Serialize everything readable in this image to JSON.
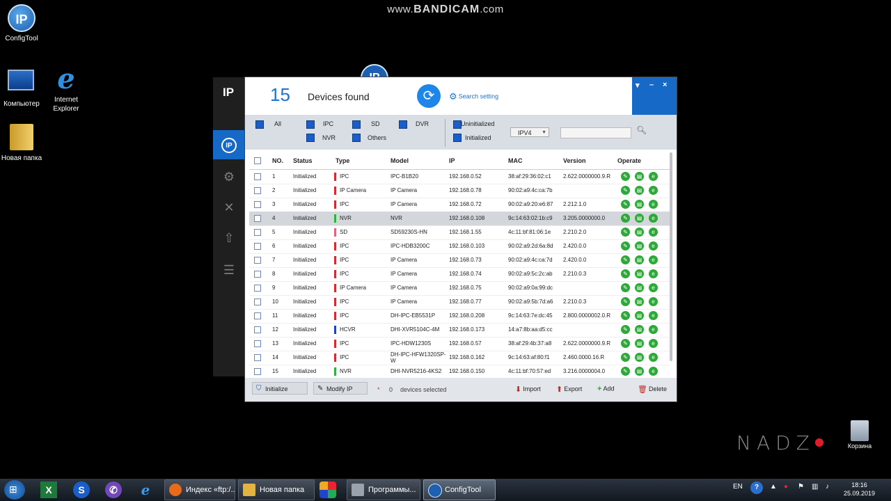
{
  "watermark": {
    "prefix": "www.",
    "brand": "BANDICAM",
    "suffix": ".com"
  },
  "corner_watermark": "NADZ",
  "desktop": {
    "icons": [
      {
        "label": "ConfigTool"
      },
      {
        "label": "Компьютер"
      },
      {
        "label": "Internet Explorer"
      },
      {
        "label": "Новая папка"
      }
    ],
    "trash_label": "Корзина"
  },
  "sidebar": {
    "logo": "IP"
  },
  "window": {
    "device_count": "15",
    "devices_found_label": "Devices found",
    "search_setting_label": "Search setting",
    "controls": {
      "menu": "▾",
      "minimize": "–",
      "close": "×"
    },
    "filters": {
      "all": "All",
      "ipc": "IPC",
      "sd": "SD",
      "dvr": "DVR",
      "nvr": "NVR",
      "others": "Others",
      "uninitialized": "Uninitialized",
      "initialized": "Initialized",
      "ip_version": "IPV4"
    },
    "columns": [
      "NO.",
      "Status",
      "Type",
      "Model",
      "IP",
      "MAC",
      "Version",
      "Operate"
    ],
    "rows": [
      {
        "no": "1",
        "status": "Initialized",
        "type": "IPC",
        "model": "IPC-B1B20",
        "ip": "192.168.0.52",
        "mac": "38:af:29:36:02:c1",
        "version": "2.622.0000000.9.R",
        "type_color": "#e0262a"
      },
      {
        "no": "2",
        "status": "Initialized",
        "type": "IP Camera",
        "model": "IP Camera",
        "ip": "192.168.0.78",
        "mac": "90:02:a9:4c:ca:7b",
        "version": "",
        "type_color": "#e0262a"
      },
      {
        "no": "3",
        "status": "Initialized",
        "type": "IPC",
        "model": "IP Camera",
        "ip": "192.168.0.72",
        "mac": "90:02:a9:20:e6:87",
        "version": "2.212.1.0",
        "type_color": "#e0262a"
      },
      {
        "no": "4",
        "status": "Initialized",
        "type": "NVR",
        "model": "NVR",
        "ip": "192.168.0.108",
        "mac": "9c:14:63:02:1b:c9",
        "version": "3.205.0000000.0",
        "type_color": "#28b33a"
      },
      {
        "no": "5",
        "status": "Initialized",
        "type": "SD",
        "model": "SD59230S-HN",
        "ip": "192.168.1.55",
        "mac": "4c:11:bf:81:06:1e",
        "version": "2.210.2.0",
        "type_color": "#e8607a"
      },
      {
        "no": "6",
        "status": "Initialized",
        "type": "IPC",
        "model": "IPC-HDB3200C",
        "ip": "192.168.0.103",
        "mac": "90:02:a9:2d:6a:8d",
        "version": "2.420.0.0",
        "type_color": "#e0262a"
      },
      {
        "no": "7",
        "status": "Initialized",
        "type": "IPC",
        "model": "IP Camera",
        "ip": "192.168.0.73",
        "mac": "90:02:a9:4c:ca:7d",
        "version": "2.420.0.0",
        "type_color": "#e0262a"
      },
      {
        "no": "8",
        "status": "Initialized",
        "type": "IPC",
        "model": "IP Camera",
        "ip": "192.168.0.74",
        "mac": "90:02:a9:5c:2c:ab",
        "version": "2.210.0.3",
        "type_color": "#e0262a"
      },
      {
        "no": "9",
        "status": "Initialized",
        "type": "IP Camera",
        "model": "IP Camera",
        "ip": "192.168.0.75",
        "mac": "90:02:a9:0a:99:dc",
        "version": "",
        "type_color": "#e0262a"
      },
      {
        "no": "10",
        "status": "Initialized",
        "type": "IPC",
        "model": "IP Camera",
        "ip": "192.168.0.77",
        "mac": "90:02:a9:5b:7d:a6",
        "version": "2.210.0.3",
        "type_color": "#e0262a"
      },
      {
        "no": "11",
        "status": "Initialized",
        "type": "IPC",
        "model": "DH-IPC-EB5531P",
        "ip": "192.168.0.208",
        "mac": "9c:14:63:7e:dc:45",
        "version": "2.800.0000002.0.R",
        "type_color": "#e0262a"
      },
      {
        "no": "12",
        "status": "Initialized",
        "type": "HCVR",
        "model": "DHI-XVR5104C-4M",
        "ip": "192.168.0.173",
        "mac": "14:a7:8b:aa:d5:cc",
        "version": "",
        "type_color": "#1d3fd0"
      },
      {
        "no": "13",
        "status": "Initialized",
        "type": "IPC",
        "model": "IPC-HDW1230S",
        "ip": "192.168.0.57",
        "mac": "38:af:29:4b:37:a8",
        "version": "2.622.0000000.9.R",
        "type_color": "#e0262a"
      },
      {
        "no": "14",
        "status": "Initialized",
        "type": "IPC",
        "model": "DH-IPC-HFW1320SP-W",
        "ip": "192.168.0.162",
        "mac": "9c:14:63:af:80:f1",
        "version": "2.460.0000.16.R",
        "type_color": "#e0262a"
      },
      {
        "no": "15",
        "status": "Initialized",
        "type": "NVR",
        "model": "DHI-NVR5216-4KS2",
        "ip": "192.168.0.150",
        "mac": "4c:11:bf:70:57:ed",
        "version": "3.216.0000004.0",
        "type_color": "#28b33a"
      }
    ],
    "footer": {
      "initialize": "Initialize",
      "modify_ip": "Modify IP",
      "selected_marker": "*",
      "selected_count": "0",
      "selected_label": "devices selected",
      "import": "Import",
      "export": "Export",
      "add": "Add",
      "delete": "Delete"
    }
  },
  "taskbar": {
    "windows": [
      {
        "label": "Индекс «ftp:/..."
      },
      {
        "label": "Новая папка"
      },
      {
        "label": "Программы..."
      },
      {
        "label": "ConfigTool"
      }
    ],
    "lang": "EN",
    "time": "18:16",
    "date": "25.09.2019"
  }
}
